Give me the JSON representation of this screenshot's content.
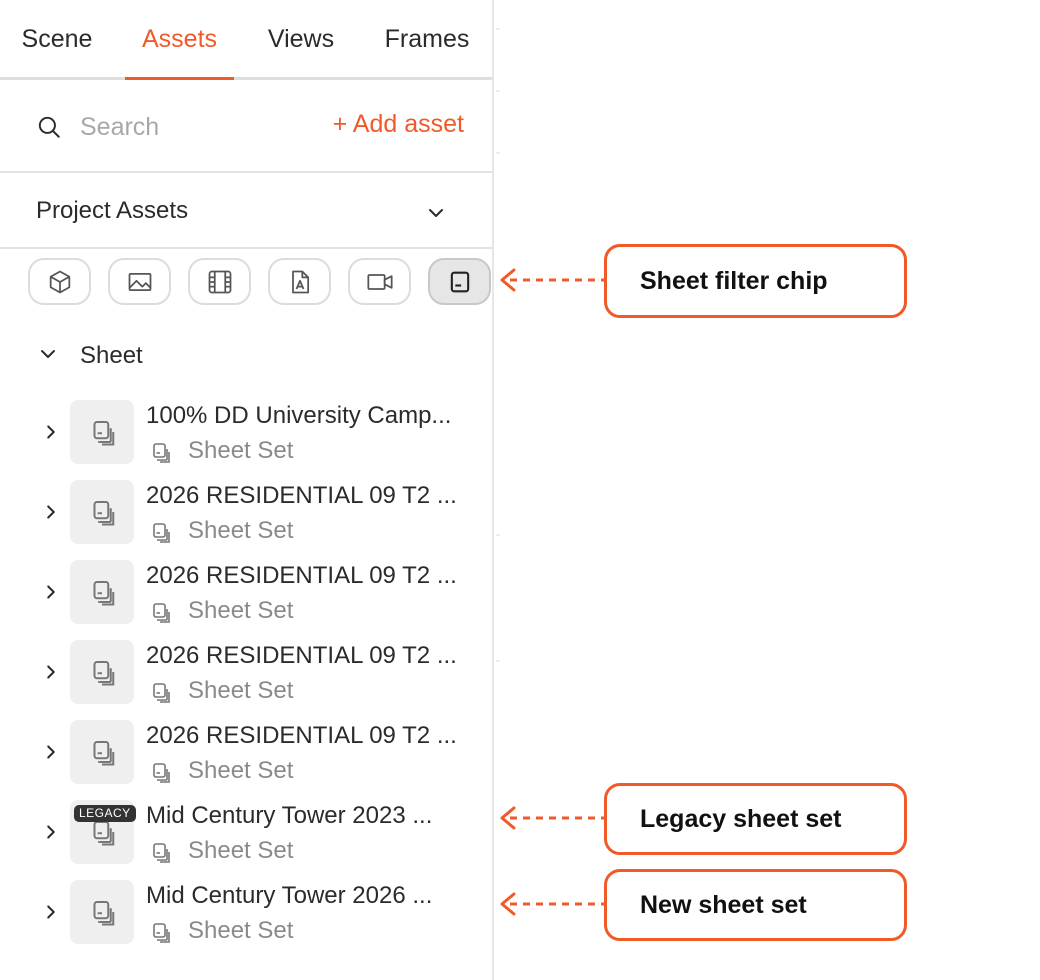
{
  "tabs": [
    {
      "label": "Scene",
      "active": false
    },
    {
      "label": "Assets",
      "active": true
    },
    {
      "label": "Views",
      "active": false
    },
    {
      "label": "Frames",
      "active": false
    }
  ],
  "search": {
    "placeholder": "Search",
    "value": "",
    "icon": "search-icon"
  },
  "add_asset_label": "+ Add asset",
  "project_selector": {
    "label": "Project Assets",
    "icon": "chevron-down-icon"
  },
  "filter_chips": [
    {
      "name": "model",
      "icon": "cube-icon",
      "selected": false
    },
    {
      "name": "image",
      "icon": "image-icon",
      "selected": false
    },
    {
      "name": "video",
      "icon": "film-icon",
      "selected": false
    },
    {
      "name": "pdf",
      "icon": "pdf-icon",
      "selected": false
    },
    {
      "name": "camera",
      "icon": "video-camera-icon",
      "selected": false
    },
    {
      "name": "sheet",
      "icon": "sheet-icon",
      "selected": true
    }
  ],
  "group": {
    "label": "Sheet",
    "expanded": true
  },
  "items": [
    {
      "title": "100% DD University Camp...",
      "subtitle": "Sheet Set",
      "badge": ""
    },
    {
      "title": "2026 RESIDENTIAL 09 T2 ...",
      "subtitle": "Sheet Set",
      "badge": ""
    },
    {
      "title": "2026 RESIDENTIAL 09 T2 ...",
      "subtitle": "Sheet Set",
      "badge": ""
    },
    {
      "title": "2026 RESIDENTIAL 09 T2 ...",
      "subtitle": "Sheet Set",
      "badge": ""
    },
    {
      "title": "2026 RESIDENTIAL 09 T2 ...",
      "subtitle": "Sheet Set",
      "badge": ""
    },
    {
      "title": "Mid Century Tower 2023 ...",
      "subtitle": "Sheet Set",
      "badge": "LEGACY"
    },
    {
      "title": "Mid Century Tower 2026 ...",
      "subtitle": "Sheet Set",
      "badge": ""
    }
  ],
  "callouts": {
    "sheet_filter": "Sheet filter chip",
    "legacy": "Legacy sheet set",
    "new": "New sheet set"
  },
  "colors": {
    "accent": "#f05a28",
    "text": "#2b2b2b",
    "muted": "#8a8a8a",
    "thumb_bg": "#efefef"
  }
}
